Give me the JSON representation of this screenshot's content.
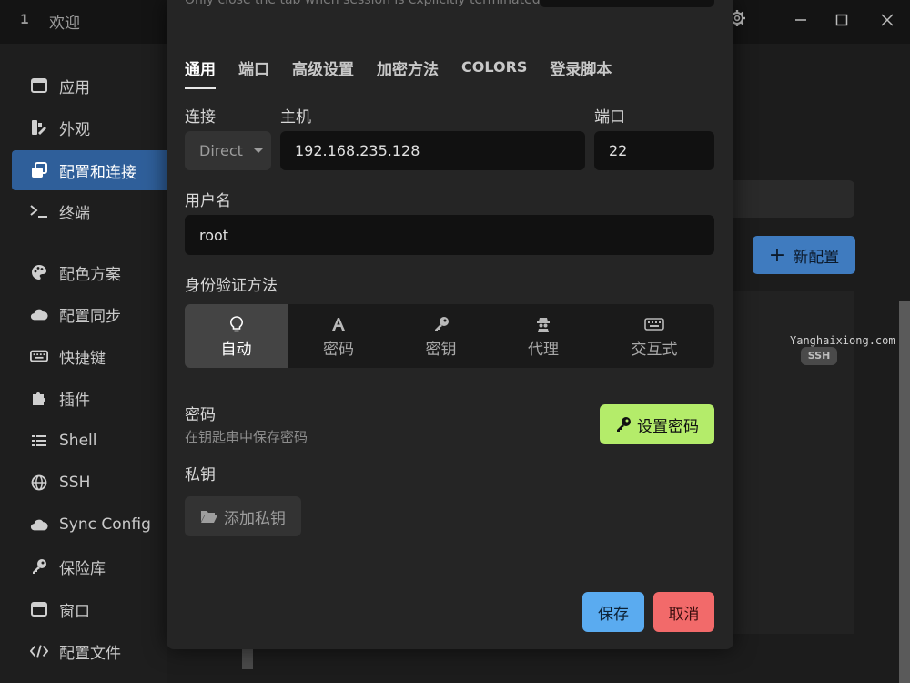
{
  "titlebar": {
    "tab_index": "1",
    "tab_title": "欢迎",
    "icons": [
      "gear-icon",
      "minimize-icon",
      "maximize-icon",
      "close-icon"
    ]
  },
  "sidebar": {
    "items": [
      {
        "label": "应用",
        "icon": "window-icon"
      },
      {
        "label": "外观",
        "icon": "palette-swatch-icon"
      },
      {
        "label": "配置和连接",
        "icon": "windows-stack-icon",
        "active": true
      },
      {
        "label": "终端",
        "icon": "terminal-icon"
      },
      {
        "label": "配色方案",
        "icon": "palette-icon"
      },
      {
        "label": "配置同步",
        "icon": "cloud-icon"
      },
      {
        "label": "快捷键",
        "icon": "keyboard-icon"
      },
      {
        "label": "插件",
        "icon": "puzzle-icon"
      },
      {
        "label": "Shell",
        "icon": "list-icon"
      },
      {
        "label": "SSH",
        "icon": "globe-icon"
      },
      {
        "label": "Sync Config",
        "icon": "cloud-icon"
      },
      {
        "label": "保险库",
        "icon": "key-icon"
      },
      {
        "label": "窗口",
        "icon": "window-icon"
      },
      {
        "label": "配置文件",
        "icon": "code-icon"
      }
    ]
  },
  "background": {
    "new_config_label": "新配置",
    "host_label": "Yanghaixiong.com",
    "badge": "SSH"
  },
  "modal": {
    "cut_text": "Only close the tab when session is explicitly terminated",
    "tabs": [
      "通用",
      "端口",
      "高级设置",
      "加密方法",
      "COLORS",
      "登录脚本"
    ],
    "connection_label": "连接",
    "connection_value": "Direct",
    "host_label": "主机",
    "host_value": "192.168.235.128",
    "port_label": "端口",
    "port_value": "22",
    "username_label": "用户名",
    "username_value": "root",
    "auth_label": "身份验证方法",
    "auth_methods": [
      {
        "label": "自动",
        "icon": "lightbulb-icon",
        "active": true
      },
      {
        "label": "密码",
        "icon": "font-icon"
      },
      {
        "label": "密钥",
        "icon": "key-icon"
      },
      {
        "label": "代理",
        "icon": "user-secret-icon"
      },
      {
        "label": "交互式",
        "icon": "keyboard-icon"
      }
    ],
    "password_label": "密码",
    "password_hint": "在钥匙串中保存密码",
    "set_password_label": "设置密码",
    "private_key_label": "私钥",
    "add_key_label": "添加私钥",
    "save_label": "保存",
    "cancel_label": "取消"
  },
  "colors": {
    "active_sidebar": "#2f5f9a",
    "new_config": "#3f7bbf",
    "set_password": "#b4ec6a",
    "save": "#5aabf0",
    "cancel": "#f26a6a"
  }
}
